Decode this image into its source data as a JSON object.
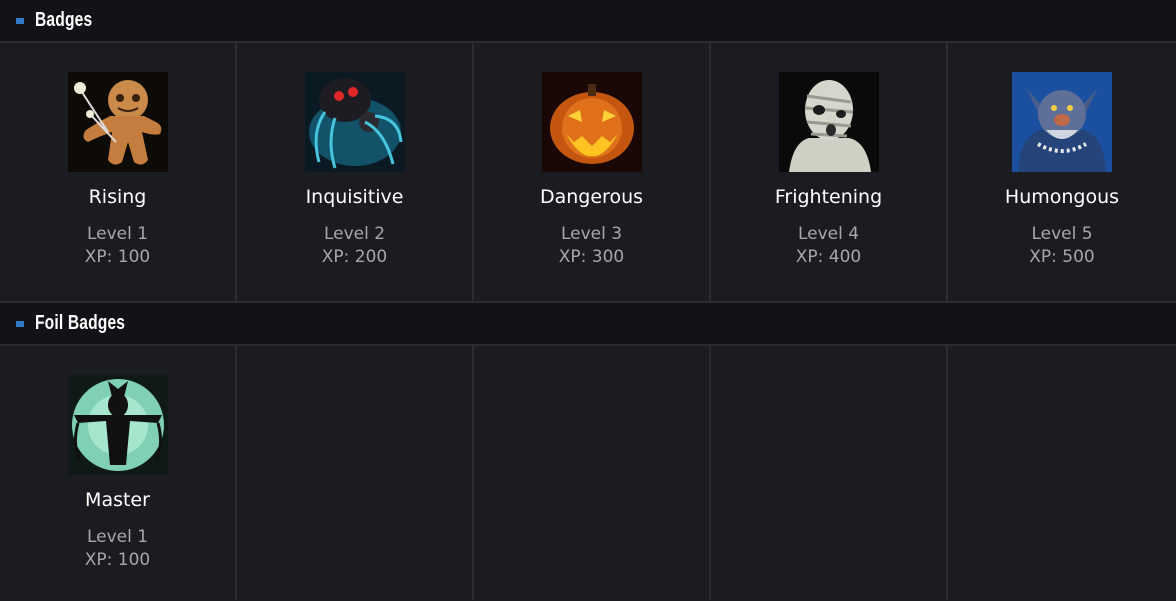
{
  "sections": [
    {
      "title": "Badges",
      "badges": [
        {
          "name": "Rising",
          "level": "Level 1",
          "xp": "XP: 100",
          "icon": "voodoo-doll-icon"
        },
        {
          "name": "Inquisitive",
          "level": "Level 2",
          "xp": "XP: 200",
          "icon": "spider-icon"
        },
        {
          "name": "Dangerous",
          "level": "Level 3",
          "xp": "XP: 300",
          "icon": "jack-o-lantern-icon"
        },
        {
          "name": "Frightening",
          "level": "Level 4",
          "xp": "XP: 400",
          "icon": "mummy-icon"
        },
        {
          "name": "Humongous",
          "level": "Level 5",
          "xp": "XP: 500",
          "icon": "troll-icon"
        }
      ]
    },
    {
      "title": "Foil Badges",
      "badges": [
        {
          "name": "Master",
          "level": "Level 1",
          "xp": "XP: 100",
          "icon": "scarecrow-icon"
        }
      ]
    }
  ],
  "colors": {
    "accent": "#2f78c4",
    "background": "#1b1c21",
    "header": "#121317"
  }
}
